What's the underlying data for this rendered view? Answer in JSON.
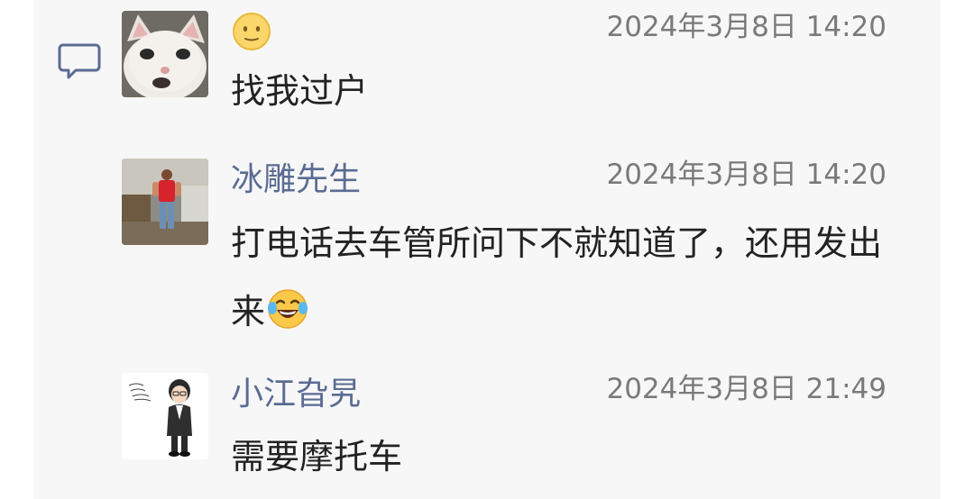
{
  "comments": [
    {
      "author": "",
      "author_display": "emoji-face",
      "time": "2024年3月8日 14:20",
      "text": "找我过户",
      "avatar": "cat-avatar"
    },
    {
      "author": "冰雕先生",
      "time": "2024年3月8日 14:20",
      "text": "打电话去车管所问下不就知道了，还用发出来",
      "trailing_emoji": "laughing-tears-emoji",
      "avatar": "man-red-shirt-avatar"
    },
    {
      "author": "小江旮旯",
      "time": "2024年3月8日 21:49",
      "text": "需要摩托车",
      "avatar": "cartoon-man-avatar"
    }
  ],
  "colors": {
    "name": "#5b6b93",
    "time": "#7a7a7a",
    "text": "#222222",
    "panel_bg": "#f7f7f7",
    "icon": "#5b6b93"
  },
  "icons": {
    "comments": "comment-bubble-icon"
  }
}
